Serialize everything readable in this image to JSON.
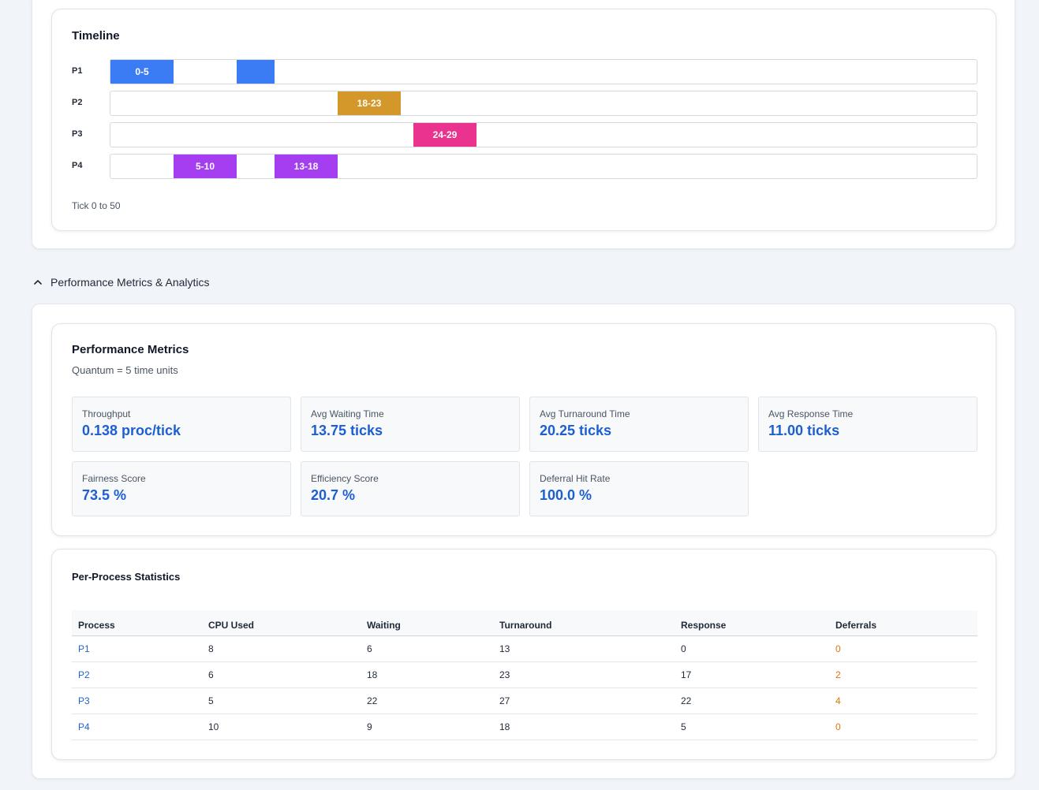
{
  "timeline": {
    "title": "Timeline",
    "caption": "Tick 0 to 50",
    "rows": [
      {
        "process": "P1",
        "segments": [
          {
            "start": 0,
            "end": 5,
            "label": "0-5",
            "color": "#3b7cf4"
          },
          {
            "start": 10,
            "end": 13,
            "label": "",
            "color": "#3b7cf4"
          }
        ]
      },
      {
        "process": "P2",
        "segments": [
          {
            "start": 18,
            "end": 23,
            "label": "18-23",
            "color": "#d4972a"
          }
        ]
      },
      {
        "process": "P3",
        "segments": [
          {
            "start": 24,
            "end": 29,
            "label": "24-29",
            "color": "#e9338f"
          }
        ]
      },
      {
        "process": "P4",
        "segments": [
          {
            "start": 5,
            "end": 10,
            "label": "5-10",
            "color": "#a43ef0"
          },
          {
            "start": 13,
            "end": 18,
            "label": "13-18",
            "color": "#a43ef0"
          }
        ]
      }
    ]
  },
  "section": {
    "label": "Performance Metrics & Analytics",
    "expanded": true
  },
  "metrics": {
    "title": "Performance Metrics",
    "subtitle": "Quantum = 5 time units",
    "items": [
      {
        "label": "Throughput",
        "value": "0.138 proc/tick"
      },
      {
        "label": "Avg Waiting Time",
        "value": "13.75 ticks"
      },
      {
        "label": "Avg Turnaround Time",
        "value": "20.25 ticks"
      },
      {
        "label": "Avg Response Time",
        "value": "11.00 ticks"
      },
      {
        "label": "Fairness Score",
        "value": "73.5 %"
      },
      {
        "label": "Efficiency Score",
        "value": "20.7 %"
      },
      {
        "label": "Deferral Hit Rate",
        "value": "100.0 %"
      }
    ]
  },
  "per_process": {
    "title": "Per-Process Statistics",
    "columns": [
      "Process",
      "CPU Used",
      "Waiting",
      "Turnaround",
      "Response",
      "Deferrals"
    ],
    "rows": [
      [
        "P1",
        "8",
        "6",
        "13",
        "0",
        "0"
      ],
      [
        "P2",
        "6",
        "18",
        "23",
        "17",
        "2"
      ],
      [
        "P3",
        "5",
        "22",
        "27",
        "22",
        "4"
      ],
      [
        "P4",
        "10",
        "9",
        "18",
        "5",
        "0"
      ]
    ]
  },
  "colors": {
    "accent": "#1d5fd0",
    "link": "#2563c9",
    "deferral": "#d97706"
  }
}
